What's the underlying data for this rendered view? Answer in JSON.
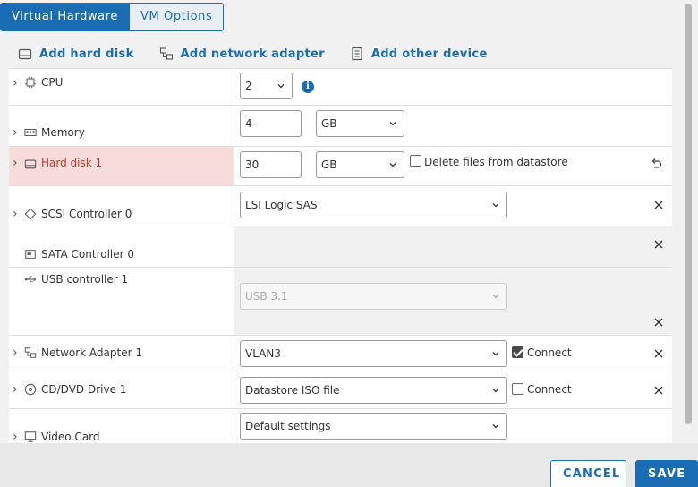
{
  "tabs": [
    {
      "label": "Virtual Hardware",
      "active": true
    },
    {
      "label": "VM Options",
      "active": false
    }
  ],
  "toolbar": {
    "add_hard_disk": "Add hard disk",
    "add_network_adapter": "Add network adapter",
    "add_other_device": "Add other device"
  },
  "devices": {
    "cpu": {
      "label": "CPU",
      "value": "2",
      "icon": "cpu-icon"
    },
    "memory": {
      "label": "Memory",
      "value": "4",
      "unit": "GB",
      "icon": "memory-icon"
    },
    "hard_disk": {
      "label": "Hard disk 1",
      "value": "30",
      "unit": "GB",
      "delete_label": "Delete files from datastore",
      "delete_checked": false,
      "icon": "hard-disk-icon"
    },
    "scsi": {
      "label": "SCSI Controller 0",
      "value": "LSI Logic SAS",
      "icon": "scsi-controller-icon"
    },
    "sata": {
      "label": "SATA Controller 0",
      "icon": "sata-controller-icon"
    },
    "usb": {
      "label": "USB controller 1",
      "value": "USB 3.1",
      "icon": "usb-icon"
    },
    "network": {
      "label": "Network Adapter 1",
      "value": "VLAN3",
      "connect_label": "Connect",
      "connect_checked": true,
      "icon": "network-adapter-icon"
    },
    "cdrom": {
      "label": "CD/DVD Drive 1",
      "value": "Datastore ISO file",
      "connect_label": "Connect",
      "connect_checked": false,
      "icon": "cd-dvd-icon"
    },
    "video": {
      "label": "Video Card",
      "value": "Default settings",
      "icon": "video-card-icon"
    }
  },
  "footer": {
    "cancel": "CANCEL",
    "save": "SAVE"
  },
  "colors": {
    "accent": "#1a6db3",
    "error_bg": "#f8dcdc",
    "error_text": "#c0392b"
  }
}
